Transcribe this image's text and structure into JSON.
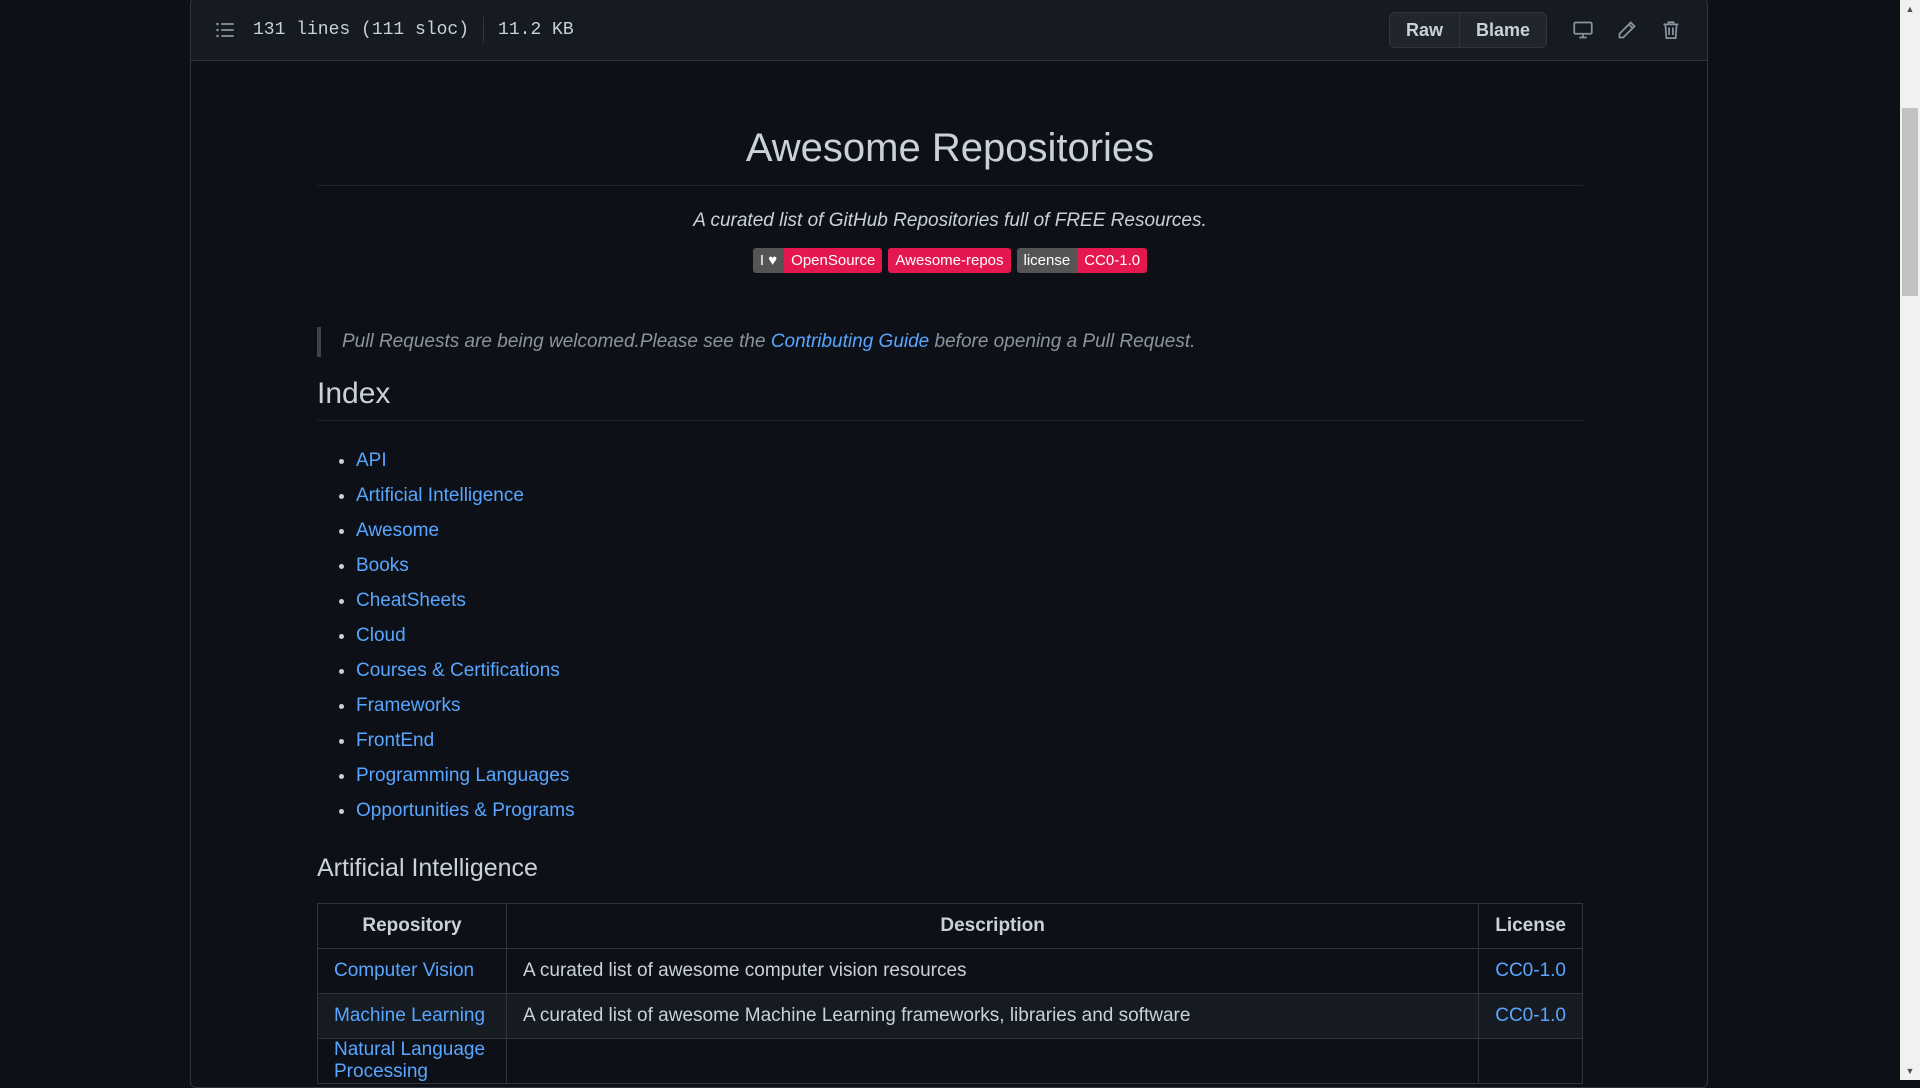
{
  "file_header": {
    "lines": "131 lines (111 sloc)",
    "size": "11.2 KB",
    "raw_label": "Raw",
    "blame_label": "Blame"
  },
  "readme": {
    "title": "Awesome Repositories",
    "subtitle": "A curated list of GitHub Repositories full of FREE Resources.",
    "badges": [
      {
        "left": "I ♥",
        "right": "OpenSource"
      },
      {
        "right": "Awesome-repos"
      },
      {
        "left": "license",
        "right": "CC0-1.0"
      }
    ],
    "quote": {
      "before": "Pull Requests are being welcomed.Please see the ",
      "link": "Contributing Guide",
      "after": " before opening a Pull Request."
    },
    "index_heading": "Index",
    "index": [
      "API",
      "Artificial Intelligence",
      "Awesome",
      "Books",
      "CheatSheets",
      "Cloud",
      "Courses & Certifications",
      "Frameworks",
      "FrontEnd",
      "Programming Languages",
      "Opportunities & Programs"
    ],
    "ai_heading": "Artificial Intelligence",
    "table": {
      "headers": [
        "Repository",
        "Description",
        "License"
      ],
      "rows": [
        {
          "repo": "Computer Vision",
          "desc": "A curated list of awesome computer vision resources",
          "license": "CC0-1.0"
        },
        {
          "repo": "Machine Learning",
          "desc": "A curated list of awesome Machine Learning frameworks, libraries and software",
          "license": "CC0-1.0"
        },
        {
          "repo": "Natural Language Processing",
          "desc": "",
          "license": ""
        }
      ]
    }
  },
  "colors": {
    "background": "#0d1117",
    "link": "#58a6ff",
    "badge_red": "#e4174f",
    "badge_gray": "#555555"
  },
  "icons": [
    "list-unordered-icon",
    "desktop-icon",
    "pencil-icon",
    "trash-icon"
  ]
}
